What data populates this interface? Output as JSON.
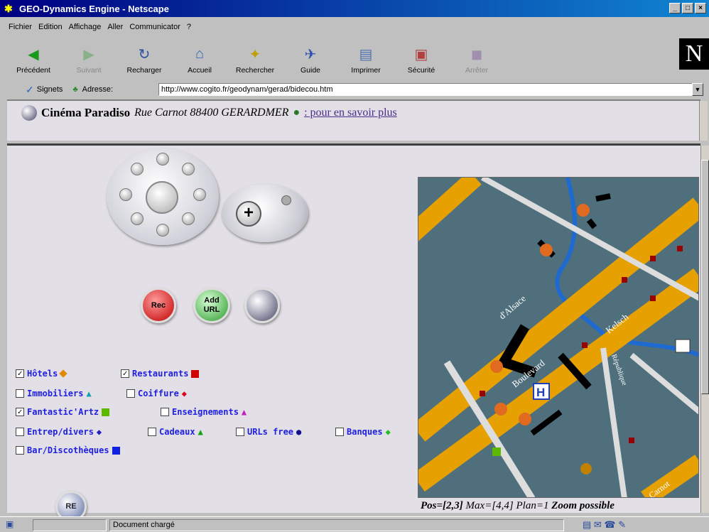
{
  "window": {
    "title": "GEO-Dynamics Engine - Netscape"
  },
  "menu": [
    "Fichier",
    "Edition",
    "Affichage",
    "Aller",
    "Communicator",
    "?"
  ],
  "toolbar": [
    {
      "label": "Précédent",
      "icon": "back-arrow-icon"
    },
    {
      "label": "Suivant",
      "icon": "forward-arrow-icon",
      "disabled": true
    },
    {
      "label": "Recharger",
      "icon": "reload-icon"
    },
    {
      "label": "Accueil",
      "icon": "home-icon"
    },
    {
      "label": "Rechercher",
      "icon": "search-icon"
    },
    {
      "label": "Guide",
      "icon": "guide-icon"
    },
    {
      "label": "Imprimer",
      "icon": "print-icon"
    },
    {
      "label": "Sécurité",
      "icon": "security-lock-icon"
    },
    {
      "label": "Arrêter",
      "icon": "stop-icon",
      "disabled": true
    }
  ],
  "logo": "N",
  "location": {
    "bookmarks": "Signets",
    "address_label": "Adresse:",
    "url": "http://www.cogito.fr/geodynam/gerad/bidecou.htm"
  },
  "header": {
    "name": "Cinéma Paradiso",
    "address": "Rue Carnot 88400 GERARDMER",
    "link": ": pour en savoir plus"
  },
  "controls": {
    "rec": "Rec",
    "add_url": "Add URL",
    "re": "RE"
  },
  "options": [
    {
      "label": "Hôtels",
      "checked": true,
      "marker_color": "#e08a00",
      "marker": "diamond"
    },
    {
      "label": "Restaurants",
      "checked": true,
      "marker_color": "#d00000",
      "marker": "square"
    },
    {
      "label": "Immobiliers",
      "checked": false,
      "marker_color": "#1aa0b0",
      "marker": "triangle"
    },
    {
      "label": "Coiffure",
      "checked": false,
      "marker_color": "#e00020",
      "marker": "diamond"
    },
    {
      "label": "Fantastic'Artz",
      "checked": true,
      "marker_color": "#5cb800",
      "marker": "square"
    },
    {
      "label": "Enseignements",
      "checked": false,
      "marker_color": "#c020c0",
      "marker": "triangle"
    },
    {
      "label": "Entrep/divers",
      "checked": false,
      "marker_color": "#2020d0",
      "marker": "diamond"
    },
    {
      "label": "Cadeaux",
      "checked": false,
      "marker_color": "#10a010",
      "marker": "triangle"
    },
    {
      "label": "URLs free",
      "checked": false,
      "marker_color": "#101090",
      "marker": "circle"
    },
    {
      "label": "Banques",
      "checked": false,
      "marker_color": "#20c020",
      "marker": "diamond"
    },
    {
      "label": "Bar/Discothèques",
      "checked": false,
      "marker_color": "#1020e0",
      "marker": "square"
    }
  ],
  "map": {
    "streets": [
      "d'Alsace",
      "Kelsch",
      "Boulevard",
      "Carnot",
      "République",
      "H"
    ],
    "caption": {
      "pos": "Pos=[2,3]",
      "max": "Max=[4,4]",
      "plan": "Plan=1",
      "zoom": "Zoom possible"
    }
  },
  "status": {
    "text": "Document chargé"
  }
}
